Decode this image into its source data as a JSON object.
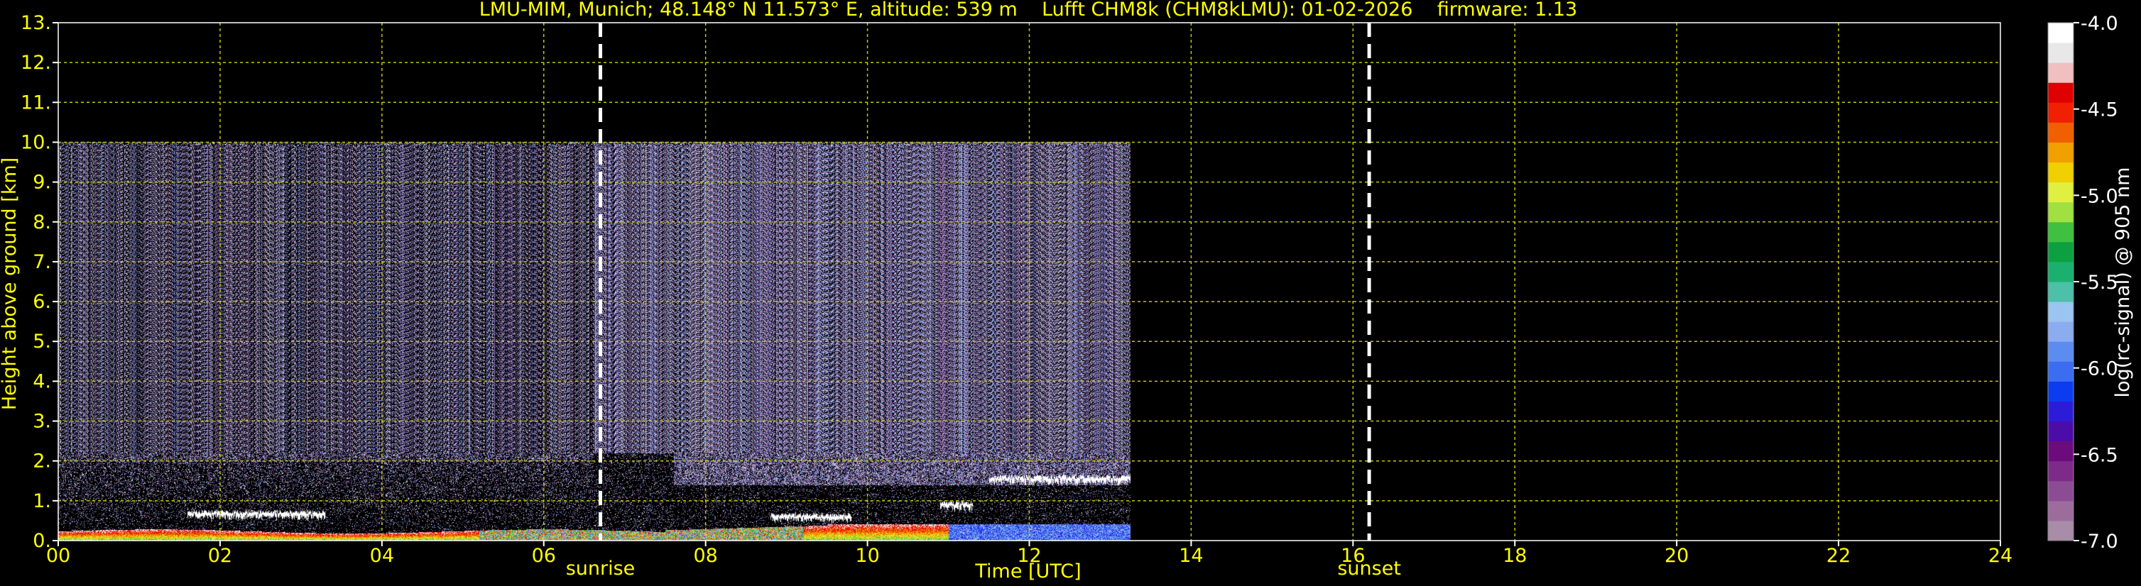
{
  "chart_data": {
    "type": "heatmap",
    "title": "LMU-MIM, Munich; 48.148° N 11.573° E, altitude: 539 m    Lufft CHM8k (CHM8kLMU): 01-02-2026    firmware: 1.13",
    "xlabel": "Time [UTC]",
    "ylabel": "Height above ground [km]",
    "colorbar_label": "log(rc-signal) @ 905 nm",
    "xlim": [
      0,
      24
    ],
    "ylim": [
      0,
      13
    ],
    "x_ticks": [
      0,
      2,
      4,
      6,
      8,
      10,
      12,
      14,
      16,
      18,
      20,
      22,
      24
    ],
    "x_tick_labels": [
      "00",
      "02",
      "04",
      "06",
      "08",
      "10",
      "12",
      "14",
      "16",
      "18",
      "20",
      "22",
      "24"
    ],
    "y_ticks": [
      0,
      1,
      2,
      3,
      4,
      5,
      6,
      7,
      8,
      9,
      10,
      11,
      12,
      13
    ],
    "y_tick_labels": [
      "0.",
      "1.",
      "2.",
      "3.",
      "4.",
      "5.",
      "6.",
      "7.",
      "8.",
      "9.",
      "10.",
      "11.",
      "12.",
      "13."
    ],
    "colorbar_range": [
      -7.0,
      -4.0
    ],
    "colorbar_ticks": [
      -7.0,
      -6.5,
      -6.0,
      -5.5,
      -5.0,
      -4.5,
      -4.0
    ],
    "colorbar_tick_labels": [
      "-7.0",
      "-6.5",
      "-6.0",
      "-5.5",
      "-5.0",
      "-4.5",
      "-4.0"
    ],
    "colorbar_colors": [
      "#a88ca8",
      "#9c6c9c",
      "#8c4c94",
      "#7c2c88",
      "#6c0c7c",
      "#4c0ca8",
      "#2c1cd8",
      "#0c3cf0",
      "#3c6cf0",
      "#5c8cf0",
      "#8cacf0",
      "#9cc4f0",
      "#4cc0a8",
      "#1cb070",
      "#0ca040",
      "#40c040",
      "#a0e040",
      "#e0f040",
      "#f0d000",
      "#f0a000",
      "#f06000",
      "#f02000",
      "#e00000",
      "#f0c0c0",
      "#e8e8e8",
      "#ffffff"
    ],
    "data_extent": {
      "time_end_hours": 13.25,
      "max_height_km": 10.0
    },
    "markers": [
      {
        "label": "sunrise",
        "x": 6.7
      },
      {
        "label": "sunset",
        "x": 16.2
      }
    ],
    "grid": true,
    "axis_color": "#ffff00",
    "grid_color": "#c8c800"
  }
}
